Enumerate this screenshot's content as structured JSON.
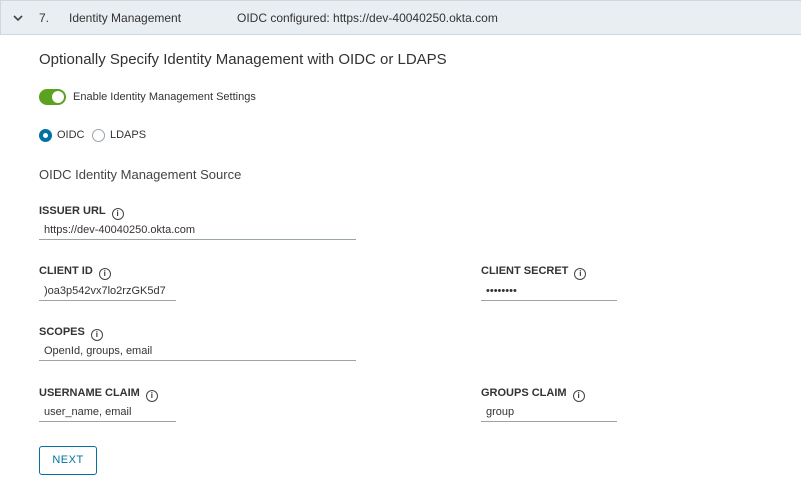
{
  "header": {
    "step_number": "7.",
    "step_title": "Identity Management",
    "status": "OIDC configured: https://dev-40040250.okta.com"
  },
  "page_title": "Optionally Specify Identity Management with OIDC or LDAPS",
  "toggle": {
    "label": "Enable Identity Management Settings",
    "enabled": true,
    "color": "#5aa220"
  },
  "protocol": {
    "options": [
      {
        "label": "OIDC",
        "selected": true
      },
      {
        "label": "LDAPS",
        "selected": false
      }
    ]
  },
  "section_title": "OIDC Identity Management Source",
  "fields": {
    "issuer_url": {
      "label": "ISSUER URL",
      "value": "https://dev-40040250.okta.com"
    },
    "client_id": {
      "label": "CLIENT ID",
      "value": ")oa3p542vx7lo2rzGK5d7"
    },
    "client_secret": {
      "label": "CLIENT SECRET",
      "value": "••••••••"
    },
    "scopes": {
      "label": "SCOPES",
      "value": "OpenId, groups, email"
    },
    "username_claim": {
      "label": "USERNAME CLAIM",
      "value": "user_name, email"
    },
    "groups_claim": {
      "label": "GROUPS CLAIM",
      "value": "group"
    }
  },
  "next_button": "NEXT",
  "colors": {
    "accent": "#0072a3",
    "header_bg": "#e9eef2"
  }
}
